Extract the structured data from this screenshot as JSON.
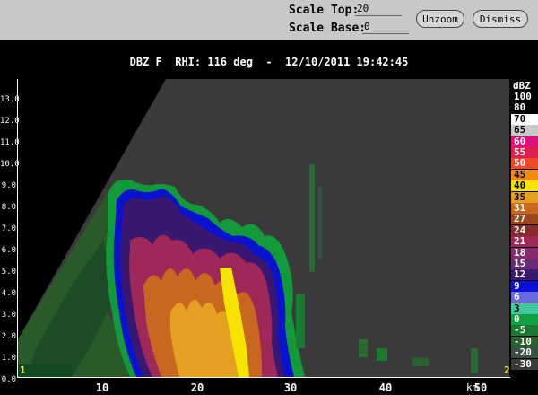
{
  "controls": {
    "scale_top_label": "Scale Top:",
    "scale_top_value": "20",
    "scale_base_label": "Scale Base:",
    "scale_base_value": "0",
    "unzoom_label": "Unzoom",
    "dismiss_label": "Dismiss"
  },
  "title": "DBZ F  RHI: 116 deg  -  12/10/2011 19:42:45",
  "axes": {
    "y_ticks": [
      "13.0",
      "12.0",
      "11.0",
      "10.0",
      "9.0",
      "8.0",
      "7.0",
      "6.0",
      "5.0",
      "4.0",
      "3.0",
      "2.0",
      "1.0",
      "0.0"
    ],
    "x_ticks": [
      "10",
      "20",
      "30",
      "40",
      "50"
    ],
    "x_unit": "km",
    "corner_left": "1",
    "corner_right": "2"
  },
  "legend": {
    "title": "dBZ",
    "entries": [
      {
        "label": "100",
        "bg": "#000000",
        "fg": "#ffffff"
      },
      {
        "label": "80",
        "bg": "#000000",
        "fg": "#ffffff"
      },
      {
        "label": "70",
        "bg": "#ffffff",
        "fg": "#000000"
      },
      {
        "label": "65",
        "bg": "#c8c8c8",
        "fg": "#000000"
      },
      {
        "label": "60",
        "bg": "#e0107a",
        "fg": "#ffffff"
      },
      {
        "label": "55",
        "bg": "#e02050",
        "fg": "#ffffff"
      },
      {
        "label": "50",
        "bg": "#ef4a2a",
        "fg": "#ffffff"
      },
      {
        "label": "45",
        "bg": "#f08a10",
        "fg": "#000000"
      },
      {
        "label": "40",
        "bg": "#f5e400",
        "fg": "#000000"
      },
      {
        "label": "35",
        "bg": "#e4a020",
        "fg": "#000000"
      },
      {
        "label": "31",
        "bg": "#c86820",
        "fg": "#ffffff"
      },
      {
        "label": "27",
        "bg": "#9a4a1a",
        "fg": "#ffffff"
      },
      {
        "label": "24",
        "bg": "#8a2a2a",
        "fg": "#ffffff"
      },
      {
        "label": "21",
        "bg": "#a02858",
        "fg": "#ffffff"
      },
      {
        "label": "18",
        "bg": "#882a70",
        "fg": "#ffffff"
      },
      {
        "label": "15",
        "bg": "#6a2a78",
        "fg": "#ffffff"
      },
      {
        "label": "12",
        "bg": "#3a1870",
        "fg": "#ffffff"
      },
      {
        "label": "9",
        "bg": "#0a10d8",
        "fg": "#ffffff"
      },
      {
        "label": "6",
        "bg": "#6a6ae0",
        "fg": "#ffffff"
      },
      {
        "label": "3",
        "bg": "#40c8a0",
        "fg": "#000000"
      },
      {
        "label": "0",
        "bg": "#10a040",
        "fg": "#ffffff"
      },
      {
        "label": "-5",
        "bg": "#1a7a30",
        "fg": "#ffffff"
      },
      {
        "label": "-10",
        "bg": "#2a6030",
        "fg": "#ffffff"
      },
      {
        "label": "-20",
        "bg": "#3a5040",
        "fg": "#ffffff"
      },
      {
        "label": "-30",
        "bg": "#3a3a3a",
        "fg": "#ffffff"
      }
    ]
  }
}
